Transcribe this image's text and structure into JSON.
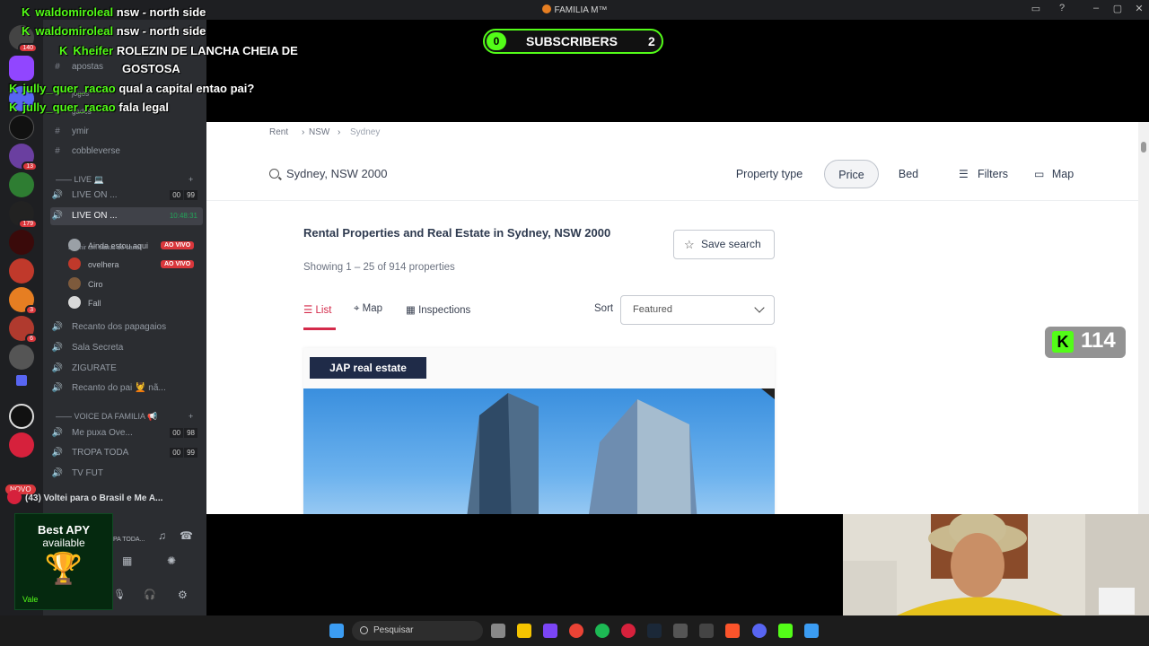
{
  "window": {
    "title": "FAMILIA M™"
  },
  "rail": {
    "badges": [
      "140",
      "13",
      "179",
      "3",
      "6"
    ],
    "novo": "NOVO"
  },
  "channels": {
    "items": [
      {
        "sym": "#",
        "label": "apostas"
      },
      {
        "sym": "#",
        "label": "jogos"
      },
      {
        "sym": "#",
        "label": "gados"
      },
      {
        "sym": "#",
        "label": "ymir"
      },
      {
        "sym": "#",
        "label": "cobbleverse"
      }
    ],
    "live_category": "LIVE",
    "voice1": {
      "label": "LIVE ON ...",
      "c1": "00",
      "c2": "99"
    },
    "voice2": {
      "label": "LIVE ON ...",
      "timer": "10:48:31"
    },
    "status_hint": "Definir um status do canal",
    "members": [
      {
        "name": "Ainda estou aqui",
        "tag": "AO VIVO",
        "color": "#9aa0a6"
      },
      {
        "name": "ovelhera",
        "tag": "AO VIVO",
        "color": "#c0392b"
      },
      {
        "name": "Ciro",
        "tag": "",
        "color": "#7d5a3c"
      },
      {
        "name": "Fall",
        "tag": "",
        "color": "#d9d9d9"
      }
    ],
    "voice_more": [
      {
        "label": "Recanto dos papagaios"
      },
      {
        "label": "Sala Secreta"
      },
      {
        "label": "ZIGURATE"
      },
      {
        "label": "Recanto do pai 💆 nã..."
      }
    ],
    "family_category": "VOICE DA FAMILIA",
    "family": [
      {
        "label": "Me puxa Ove...",
        "c1": "00",
        "c2": "98"
      },
      {
        "label": "TROPA TODA",
        "c1": "00",
        "c2": "99"
      },
      {
        "label": "TV FUT",
        "c1": "",
        "c2": ""
      }
    ],
    "activity": "(43) Voltei para o Brasil e Me A...",
    "tropa_toda": "PA TODA..."
  },
  "promo": {
    "line1": "Best APY",
    "line2": "available",
    "vale": "Vale"
  },
  "chat": [
    {
      "user": "waldomiroleal",
      "msg": "nsw - north side"
    },
    {
      "user": "waldomiroleal",
      "msg": "nsw - north side"
    },
    {
      "user": "Kheifer",
      "msg": "ROLEZIN DE LANCHA CHEIA DE"
    },
    {
      "user": "",
      "msg": "GOSTOSA"
    },
    {
      "user": "jully_quer_racao",
      "msg": "qual a capital entao pai?"
    },
    {
      "user": "jully_quer_racao",
      "msg": "fala legal"
    }
  ],
  "subscribers": {
    "left": "0",
    "label": "SUBSCRIBERS",
    "right": "2"
  },
  "kick_count": "114",
  "site": {
    "breadcrumb": [
      "Rent",
      "NSW",
      "Sydney"
    ],
    "search_value": "Sydney, NSW 2000",
    "filters": {
      "property_type": "Property type",
      "price": "Price",
      "bed": "Bed",
      "filters": "Filters",
      "map": "Map"
    },
    "heading": "Rental Properties and Real Estate in Sydney, NSW 2000",
    "showing": "Showing 1 – 25 of 914 properties",
    "save_search": "Save search",
    "tabs": {
      "list": "List",
      "map": "Map",
      "inspections": "Inspections"
    },
    "sort_label": "Sort",
    "sort_value": "Featured",
    "agency": "JAP real estate"
  },
  "taskbar": {
    "search_placeholder": "Pesquisar"
  },
  "colors": {
    "kick_green": "#53fc18",
    "accent_red": "#d42a4a",
    "discord_bg": "#2b2d31",
    "agency_navy": "#1f2b48"
  }
}
